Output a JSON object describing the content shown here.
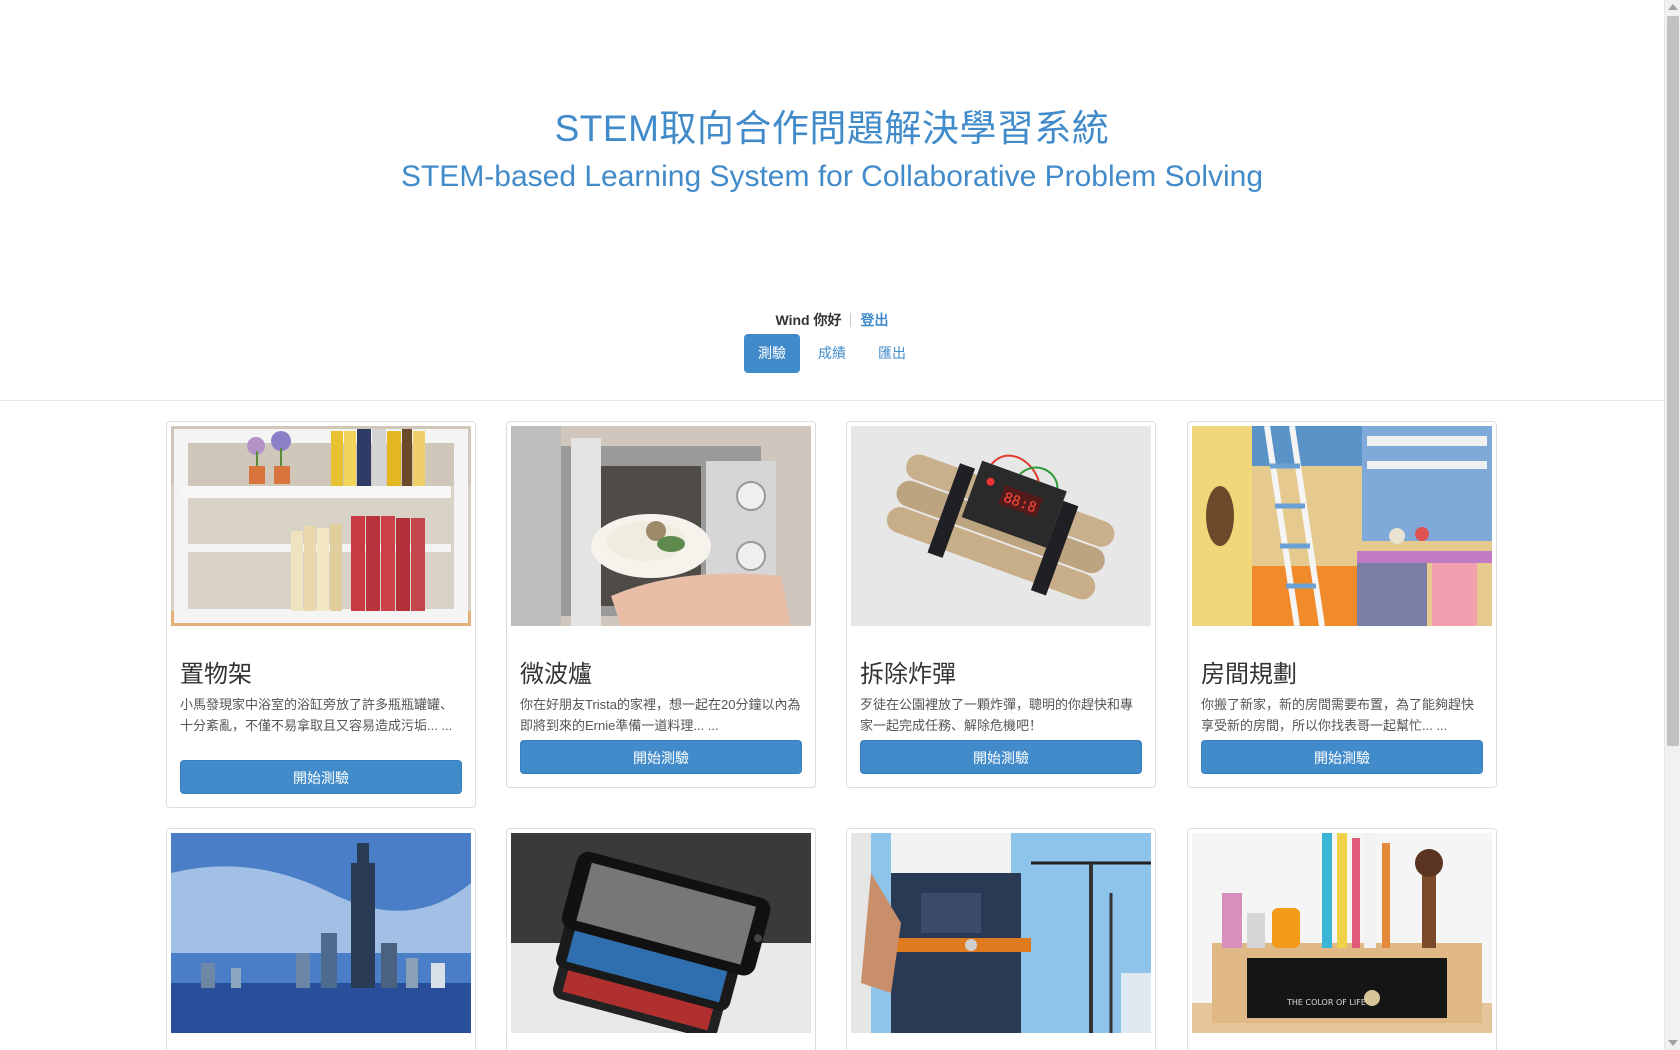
{
  "header": {
    "title_zh": "STEM取向合作問題解決學習系統",
    "title_en": "STEM-based Learning System for Collaborative Problem Solving"
  },
  "user": {
    "greeting": "Wind 你好",
    "logout_label": "登出"
  },
  "nav": {
    "items": [
      {
        "label": "測驗",
        "active": true
      },
      {
        "label": "成績",
        "active": false
      },
      {
        "label": "匯出",
        "active": false
      }
    ]
  },
  "cards": [
    {
      "title": "置物架",
      "description": "小馬發現家中浴室的浴缸旁放了許多瓶瓶罐罐、十分紊亂，不僅不易拿取且又容易造成污垢... ...",
      "button": "開始測驗",
      "image": "shelf-with-books-photo"
    },
    {
      "title": "微波爐",
      "description": "你在好朋友Trista的家裡，想一起在20分鐘以內為即將到來的Ernie準備一道料理... ...",
      "button": "開始測驗",
      "image": "microwave-photo"
    },
    {
      "title": "拆除炸彈",
      "description": "歹徒在公園裡放了一顆炸彈，聰明的你趕快和專家一起完成任務、解除危機吧！",
      "button": "開始測驗",
      "image": "time-bomb-photo"
    },
    {
      "title": "房間規劃",
      "description": "你搬了新家，新的房間需要布置，為了能夠趕快享受新的房間，所以你找表哥一起幫忙... ...",
      "button": "開始測驗",
      "image": "bedroom-photo"
    },
    {
      "image": "city-skyline-photo"
    },
    {
      "image": "smartphones-photo"
    },
    {
      "image": "construction-worker-photo"
    },
    {
      "image": "pen-holder-photo"
    }
  ],
  "colors": {
    "primary": "#428bca",
    "text": "#333333"
  }
}
